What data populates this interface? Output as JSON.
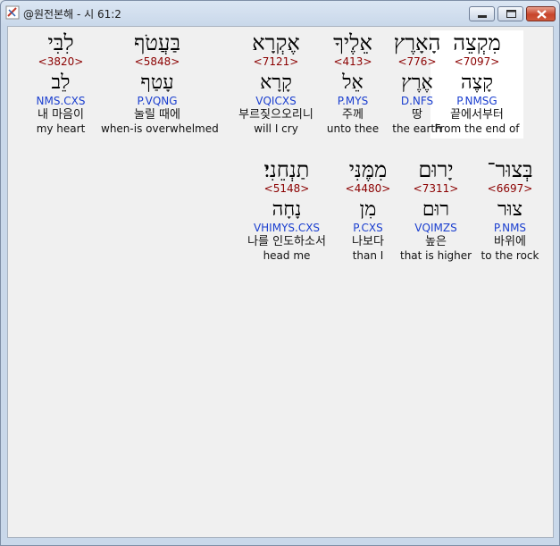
{
  "window": {
    "title": "@원전본해 - 시 61:2"
  },
  "rows": [
    {
      "words": [
        {
          "hebrew": "מִקְצֵה",
          "strong": "<7097>",
          "lemma": "קָצֶה",
          "morph": "P.NMSG",
          "korean": "끝에서부터",
          "english": "From the end of",
          "selected": true
        },
        {
          "hebrew": "הָאָרֶץ",
          "strong": "<776>",
          "lemma": "אֶרֶץ",
          "morph": "D.NFS",
          "korean": "땅",
          "english": "the earth"
        },
        {
          "hebrew": "אֵלֶיךָ",
          "strong": "<413>",
          "lemma": "אֵל",
          "morph": "P.MYS",
          "korean": "주께",
          "english": "unto thee"
        },
        {
          "hebrew": "אֶקְרָא",
          "strong": "<7121>",
          "lemma": "קָרָא",
          "morph": "VQICXS",
          "korean": "부르짖으오리니",
          "english": "will I cry"
        },
        {
          "hebrew": "בַּעֲטֹף",
          "strong": "<5848>",
          "lemma": "עָטַף",
          "morph": "P.VQNG",
          "korean": "눌릴 때에",
          "english": "when-is overwhelmed"
        },
        {
          "hebrew": "לִבִּי",
          "strong": "<3820>",
          "lemma": "לֵב",
          "morph": "NMS.CXS",
          "korean": "내 마음이",
          "english": "my heart"
        }
      ]
    },
    {
      "words": [
        {
          "hebrew": "בְּצוּר־",
          "strong": "<6697>",
          "lemma": "צוּר",
          "morph": "P.NMS",
          "korean": "바위에",
          "english": "to the rock"
        },
        {
          "hebrew": "יָרוּם",
          "strong": "<7311>",
          "lemma": "רוּם",
          "morph": "VQIMZS",
          "korean": "높은",
          "english": "that is higher"
        },
        {
          "hebrew": "מִמֶּנִּי",
          "strong": "<4480>",
          "lemma": "מִן",
          "morph": "P.CXS",
          "korean": "나보다",
          "english": "than I"
        },
        {
          "hebrew": "תַנְחֵנִי׃",
          "strong": "<5148>",
          "lemma": "נָחָה",
          "morph": "VHIMYS.CXS",
          "korean": "나를 인도하소서",
          "english": "head me"
        }
      ]
    }
  ]
}
